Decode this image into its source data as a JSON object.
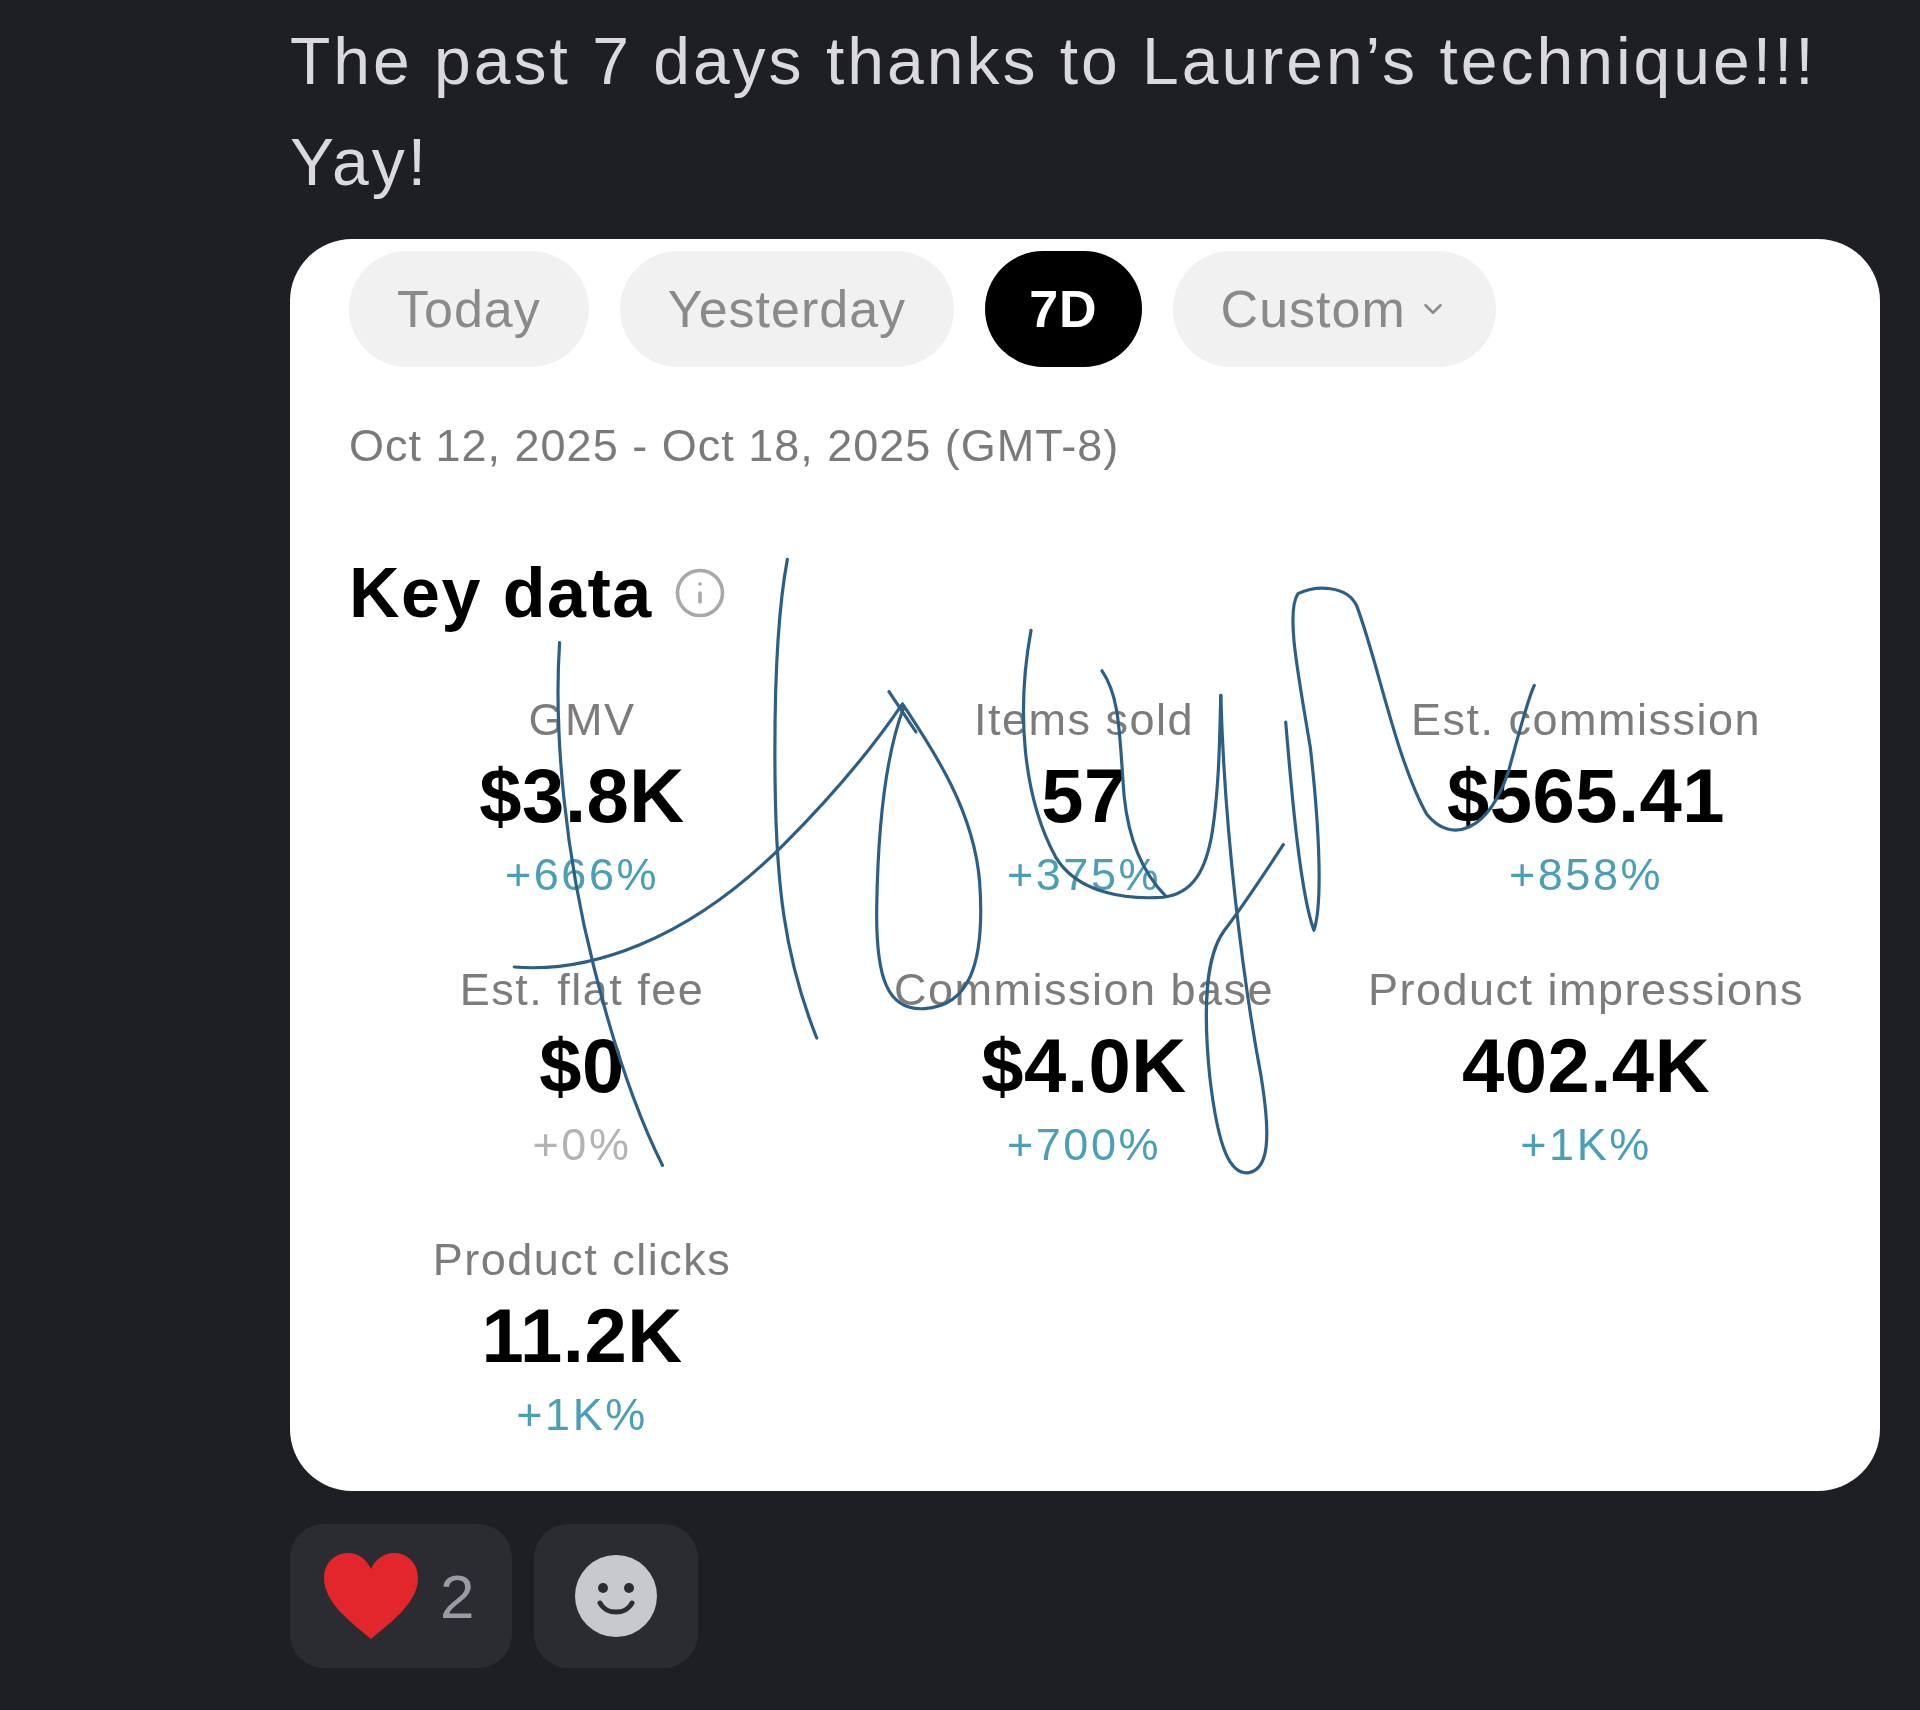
{
  "message": {
    "text": "The past 7 days thanks to Lauren’s technique!!! Yay!"
  },
  "card": {
    "tabs": [
      {
        "label": "Today",
        "selected": false,
        "dropdown": false
      },
      {
        "label": "Yesterday",
        "selected": false,
        "dropdown": false
      },
      {
        "label": "7D",
        "selected": true,
        "dropdown": false
      },
      {
        "label": "Custom",
        "selected": false,
        "dropdown": true
      }
    ],
    "date_range": "Oct 12, 2025 - Oct 18, 2025 (GMT-8)",
    "section_title": "Key data",
    "metrics": [
      {
        "label": "GMV",
        "value": "$3.8K",
        "change": "+666%",
        "color": "#4a9fb4"
      },
      {
        "label": "Items sold",
        "value": "57",
        "change": "+375%",
        "color": "#4a9fb4"
      },
      {
        "label": "Est. commission",
        "value": "$565.41",
        "change": "+858%",
        "color": "#4a9fb4"
      },
      {
        "label": "Est. flat fee",
        "value": "$0",
        "change": "+0%",
        "color": "#b3b3b3"
      },
      {
        "label": "Commission base",
        "value": "$4.0K",
        "change": "+700%",
        "color": "#4a9fb4"
      },
      {
        "label": "Product impressions",
        "value": "402.4K",
        "change": "+1K%",
        "color": "#4a9fb4"
      },
      {
        "label": "Product clicks",
        "value": "11.2K",
        "change": "+1K%",
        "color": "#4a9fb4"
      }
    ]
  },
  "reactions": [
    {
      "kind": "heart",
      "count": "2"
    }
  ]
}
